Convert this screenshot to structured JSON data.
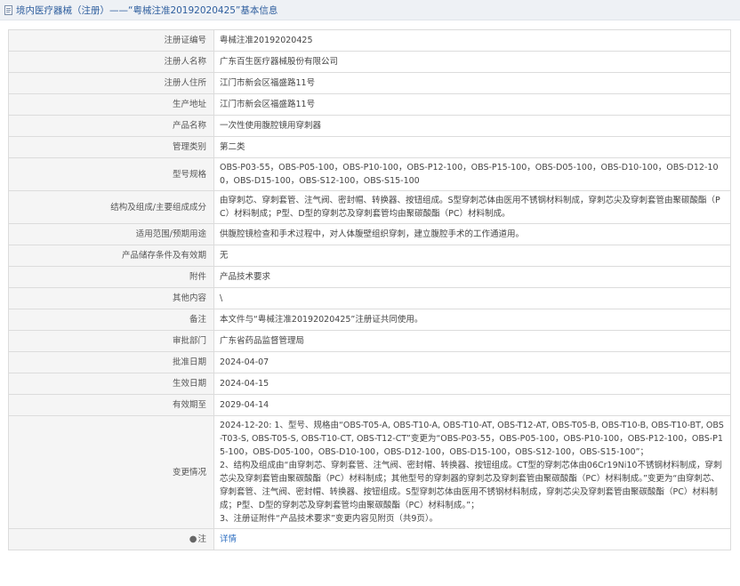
{
  "header": {
    "title": "境内医疗器械（注册）——“粤械注准20192020425”基本信息"
  },
  "rows": [
    {
      "label": "注册证编号",
      "value": "粤械注准20192020425"
    },
    {
      "label": "注册人名称",
      "value": "广东百生医疗器械股份有限公司"
    },
    {
      "label": "注册人住所",
      "value": "江门市新会区福盛路11号"
    },
    {
      "label": "生产地址",
      "value": "江门市新会区福盛路11号"
    },
    {
      "label": "产品名称",
      "value": "一次性使用腹腔镜用穿刺器"
    },
    {
      "label": "管理类别",
      "value": "第二类"
    },
    {
      "label": "型号规格",
      "value": "OBS-P03-55，OBS-P05-100，OBS-P10-100，OBS-P12-100，OBS-P15-100，OBS-D05-100，OBS-D10-100，OBS-D12-100，OBS-D15-100，OBS-S12-100，OBS-S15-100"
    },
    {
      "label": "结构及组成/主要组成成分",
      "value": "由穿刺芯、穿刺套管、注气阀、密封帽、转换器、按钮组成。S型穿刺芯体由医用不锈钢材料制成，穿刺芯尖及穿刺套管由聚碳酸酯（PC）材料制成；P型、D型的穿刺芯及穿刺套管均由聚碳酸酯（PC）材料制成。"
    },
    {
      "label": "适用范围/预期用途",
      "value": "供腹腔镜检查和手术过程中，对人体腹壁组织穿刺，建立腹腔手术的工作通道用。"
    },
    {
      "label": "产品储存条件及有效期",
      "value": "无"
    },
    {
      "label": "附件",
      "value": "产品技术要求"
    },
    {
      "label": "其他内容",
      "value": "\\"
    },
    {
      "label": "备注",
      "value": "本文件与“粤械注准20192020425”注册证共同使用。"
    },
    {
      "label": "审批部门",
      "value": "广东省药品监督管理局"
    },
    {
      "label": "批准日期",
      "value": "2024-04-07"
    },
    {
      "label": "生效日期",
      "value": "2024-04-15"
    },
    {
      "label": "有效期至",
      "value": "2029-04-14"
    },
    {
      "label": "变更情况",
      "value": "2024-12-20: 1、型号、规格由“OBS-T05-A, OBS-T10-A, OBS-T10-AT, OBS-T12-AT, OBS-T05-B, OBS-T10-B, OBS-T10-BT, OBS-T03-S, OBS-T05-S, OBS-T10-CT, OBS-T12-CT”变更为“OBS-P03-55，OBS-P05-100，OBS-P10-100，OBS-P12-100，OBS-P15-100，OBS-D05-100，OBS-D10-100，OBS-D12-100，OBS-D15-100，OBS-S12-100，OBS-S15-100”；\n2、结构及组成由“由穿刺芯、穿刺套管、注气阀、密封帽、转换器、按钮组成。CT型的穿刺芯体由06Cr19Ni10不锈钢材料制成，穿刺芯尖及穿刺套管由聚碳酸酯（PC）材料制成；其他型号的穿刺器的穿刺芯及穿刺套管由聚碳酸酯（PC）材料制成。”变更为“由穿刺芯、穿刺套管、注气阀、密封帽、转换器、按钮组成。S型穿刺芯体由医用不锈钢材料制成，穿刺芯尖及穿刺套管由聚碳酸酯（PC）材料制成；P型、D型的穿刺芯及穿刺套管均由聚碳酸酯（PC）材料制成。”；\n3、注册证附件“产品技术要求”变更内容见附页（共9页）。"
    }
  ],
  "note": {
    "label": "注",
    "link": "详情"
  },
  "colors": {
    "link": "#2e6fc1",
    "title": "#2e5e9e",
    "label_bg": "#f5f5f5"
  }
}
